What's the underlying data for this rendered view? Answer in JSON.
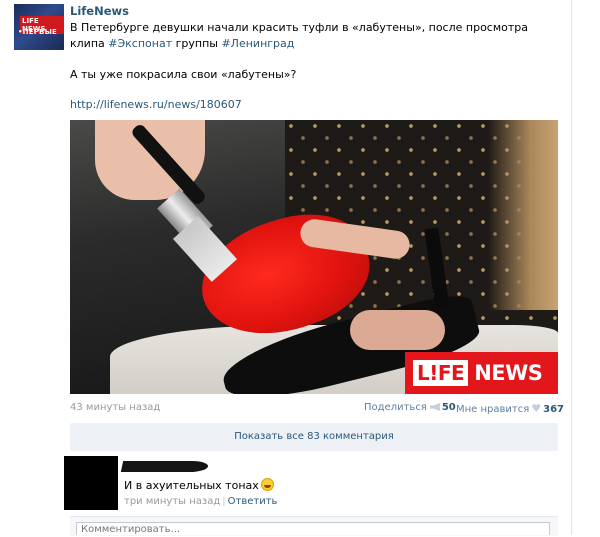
{
  "post": {
    "author": "LifeNews",
    "avatar": {
      "logo_text": "LIFE NEWS",
      "sub_text": "•ПЕРВЫЕ"
    },
    "text_main": "В Петербурге девушки начали красить туфли в «лабутены», после просмотра клипа ",
    "tag1": "#Экспонат",
    "text_mid": " группы ",
    "tag2": "#Ленинград",
    "question": "А ты уже покрасила свои «лабутены»?",
    "link": "http://lifenews.ru/news/180607",
    "photo_badge": {
      "life": "L!FE",
      "news": "NEWS"
    },
    "time": "43 минуты назад",
    "share_label": "Поделиться",
    "share_count": "50",
    "like_label": "Мне нравится",
    "like_count": "367",
    "show_all_comments": "Показать все 83 комментария"
  },
  "comment": {
    "text": "И в ахуительных тонах",
    "time": "три минуты назад",
    "reply": "Ответить"
  },
  "compose": {
    "placeholder": "Комментировать..."
  },
  "colors": {
    "link": "#2b587a",
    "badge_red": "#e3161c",
    "muted": "#999999",
    "panel": "#edf1f5"
  },
  "icons": [
    "share-megaphone-icon",
    "heart-icon",
    "grin-emoji-icon"
  ]
}
